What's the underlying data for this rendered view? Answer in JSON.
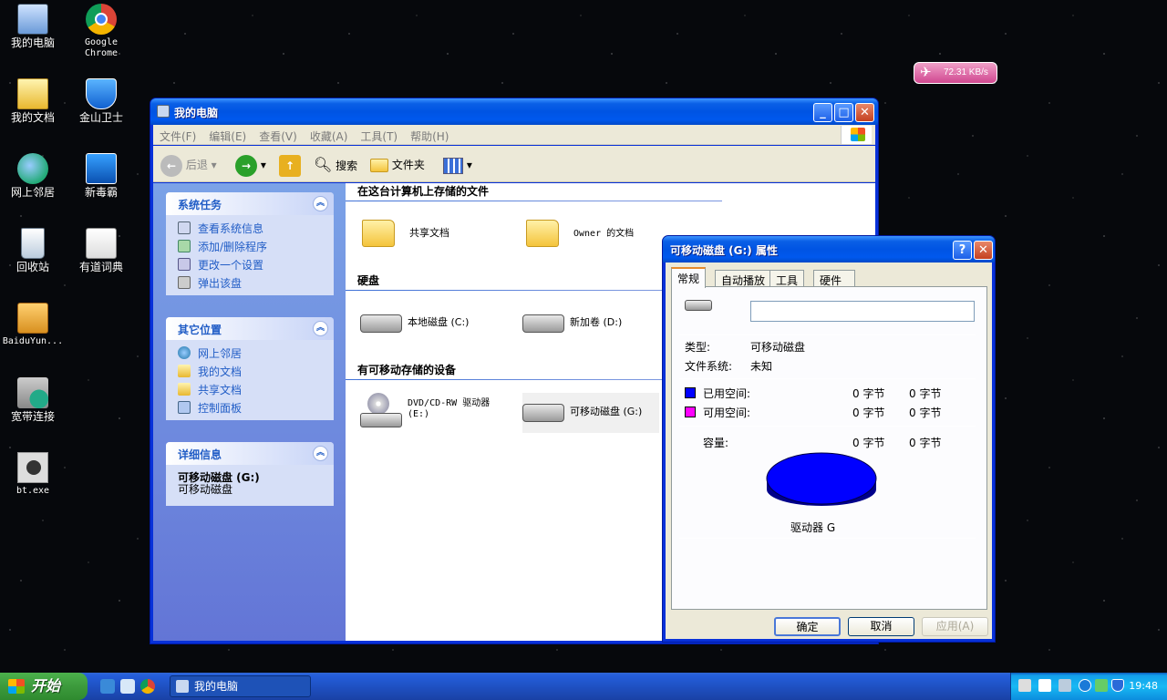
{
  "desktop": {
    "icons": [
      {
        "label": "我的电脑"
      },
      {
        "label": "Google\nChrome"
      },
      {
        "label": "我的文档"
      },
      {
        "label": "金山卫士"
      },
      {
        "label": "网上邻居"
      },
      {
        "label": "新毒霸"
      },
      {
        "label": "回收站"
      },
      {
        "label": "有道词典"
      },
      {
        "label": "BaiduYun..."
      },
      {
        "label": "宽带连接"
      },
      {
        "label": "bt.exe"
      }
    ]
  },
  "speed_widget": {
    "text": "72.31 KB/s"
  },
  "window": {
    "title": "我的电脑",
    "menu": [
      "文件(F)",
      "编辑(E)",
      "查看(V)",
      "收藏(A)",
      "工具(T)",
      "帮助(H)"
    ],
    "toolbar": {
      "back": "后退",
      "search": "搜索",
      "folders": "文件夹"
    },
    "tasks_panel": {
      "title": "系统任务",
      "items": [
        "查看系统信息",
        "添加/删除程序",
        "更改一个设置",
        "弹出该盘"
      ]
    },
    "places_panel": {
      "title": "其它位置",
      "items": [
        "网上邻居",
        "我的文档",
        "共享文档",
        "控制面板"
      ]
    },
    "details_panel": {
      "title": "详细信息",
      "name": "可移动磁盘 (G:)",
      "type": "可移动磁盘"
    },
    "groups": {
      "files": "在这台计算机上存储的文件",
      "disks": "硬盘",
      "removable": "有可移动存储的设备"
    },
    "items": {
      "shared": "共享文档",
      "owner": "Owner 的文档",
      "c": "本地磁盘 (C:)",
      "d": "新加卷 (D:)",
      "dvd": "DVD/CD-RW 驱动器\n(E:)",
      "g": "可移动磁盘 (G:)"
    }
  },
  "dialog": {
    "title": "可移动磁盘 (G:) 属性",
    "tabs": [
      "常规",
      "自动播放",
      "工具",
      "硬件"
    ],
    "label_input": "",
    "type_label": "类型:",
    "type_value": "可移动磁盘",
    "fs_label": "文件系统:",
    "fs_value": "未知",
    "used_label": "已用空间:",
    "used_bytes": "0 字节",
    "used_size": "0 字节",
    "free_label": "可用空间:",
    "free_bytes": "0 字节",
    "free_size": "0 字节",
    "cap_label": "容量:",
    "cap_bytes": "0 字节",
    "cap_size": "0 字节",
    "drive_caption": "驱动器 G",
    "used_color": "#0000ff",
    "free_color": "#ff00ff",
    "buttons": {
      "ok": "确定",
      "cancel": "取消",
      "apply": "应用(A)"
    }
  },
  "taskbar": {
    "start": "开始",
    "task": "我的电脑",
    "clock": "19:48"
  }
}
